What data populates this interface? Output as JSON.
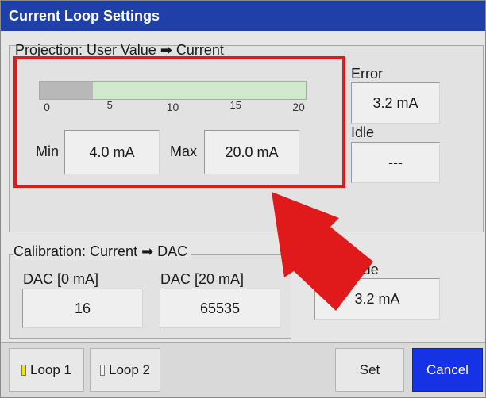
{
  "window": {
    "title": "Current Loop Settings"
  },
  "projection": {
    "title": "Projection: User Value ➡ Current",
    "bar": {
      "min": 0,
      "max": 20,
      "value": 4.0,
      "ticks": [
        "0",
        "5",
        "10",
        "15",
        "20"
      ]
    },
    "min_label": "Min",
    "min_value": "4.0 mA",
    "max_label": "Max",
    "max_value": "20.0 mA"
  },
  "error": {
    "label": "Error",
    "value": "3.2 mA"
  },
  "idle": {
    "label": "Idle",
    "value": "---"
  },
  "calibration": {
    "title": "Calibration: Current ➡ DAC",
    "dac0_label": "DAC [0 mA]",
    "dac0_value": "16",
    "dac20_label": "DAC [20 mA]",
    "dac20_value": "65535"
  },
  "test_value": {
    "label": "st Value",
    "value": "3.2 mA"
  },
  "footer": {
    "loop1_label": "Loop 1",
    "loop2_label": "Loop 2",
    "set_label": "Set",
    "cancel_label": "Cancel"
  },
  "colors": {
    "title_bar": "#1f40a8",
    "annotation": "#e01a1a",
    "bar_fill": "#b8b8b8",
    "bar_track": "#cfe9cb",
    "cancel_button": "#1632e6",
    "loop1_indicator": "#f3e600"
  }
}
